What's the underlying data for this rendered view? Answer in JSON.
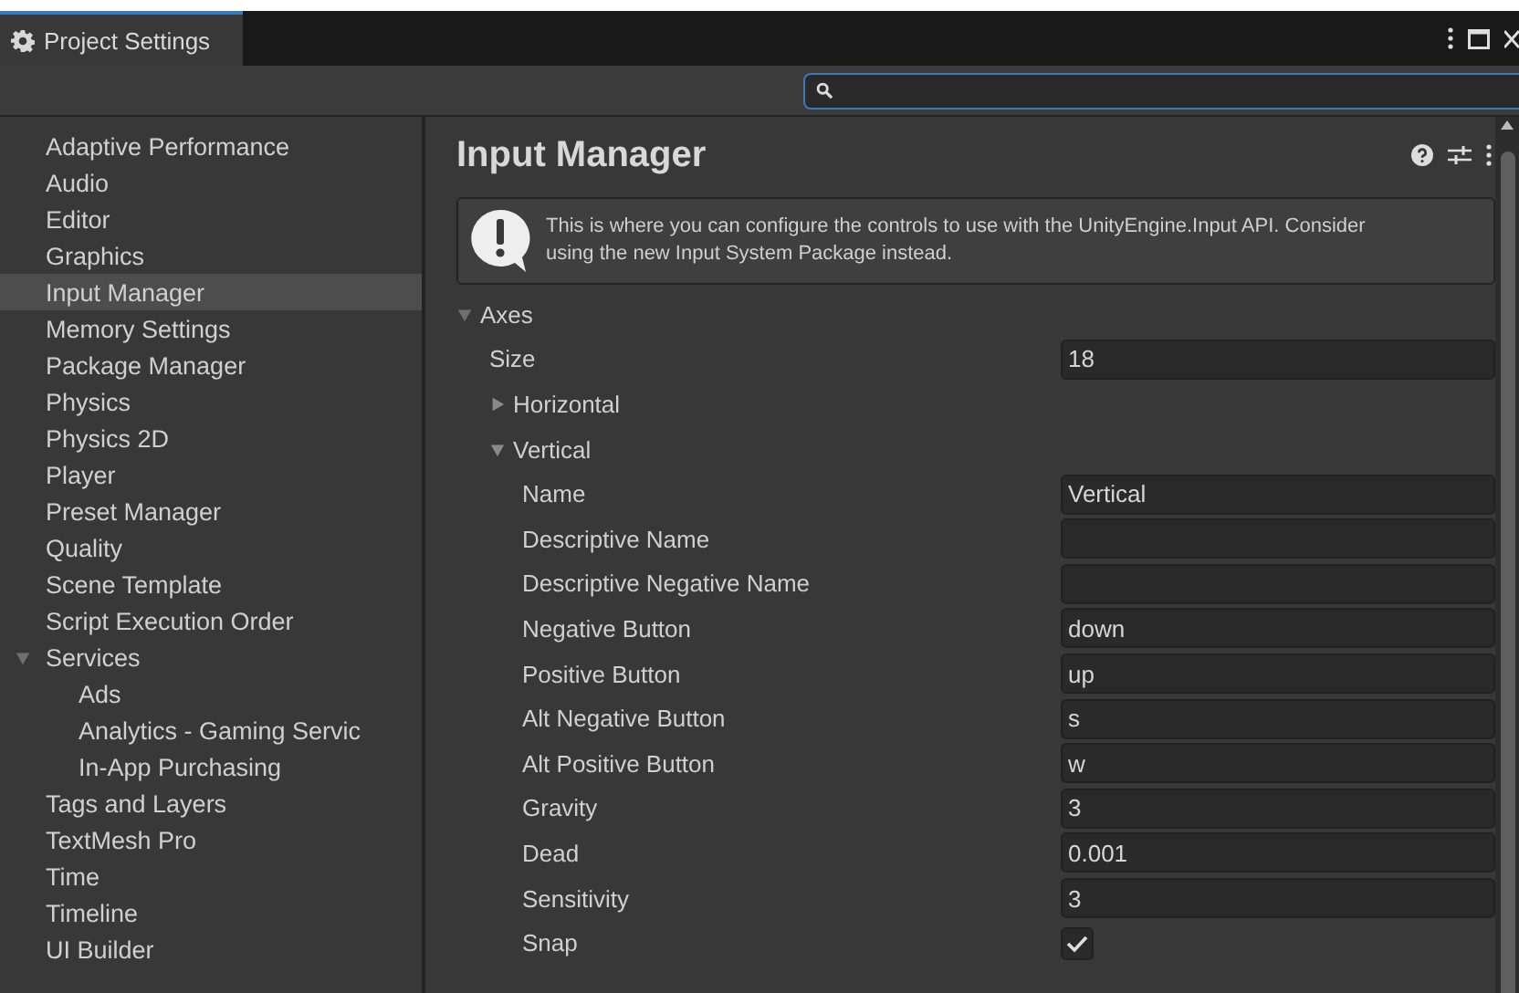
{
  "window": {
    "tab": {
      "title": "Project Settings",
      "selected": true
    }
  },
  "sidebar": {
    "items": [
      {
        "label": "Adaptive Performance",
        "selected": false
      },
      {
        "label": "Audio",
        "selected": false
      },
      {
        "label": "Editor",
        "selected": false
      },
      {
        "label": "Graphics",
        "selected": false
      },
      {
        "label": "Input Manager",
        "selected": true
      },
      {
        "label": "Memory Settings",
        "selected": false
      },
      {
        "label": "Package Manager",
        "selected": false
      },
      {
        "label": "Physics",
        "selected": false
      },
      {
        "label": "Physics 2D",
        "selected": false
      },
      {
        "label": "Player",
        "selected": false
      },
      {
        "label": "Preset Manager",
        "selected": false
      },
      {
        "label": "Quality",
        "selected": false
      },
      {
        "label": "Scene Template",
        "selected": false
      },
      {
        "label": "Script Execution Order",
        "selected": false
      },
      {
        "label": "Services",
        "selected": false,
        "expanded": true,
        "children": [
          {
            "label": "Ads",
            "selected": false
          },
          {
            "label": "Analytics - Gaming Servic",
            "selected": false
          },
          {
            "label": "In-App Purchasing",
            "selected": false
          }
        ]
      },
      {
        "label": "Tags and Layers",
        "selected": false
      },
      {
        "label": "TextMesh Pro",
        "selected": false
      },
      {
        "label": "Time",
        "selected": false
      },
      {
        "label": "Timeline",
        "selected": false
      },
      {
        "label": "UI Builder",
        "selected": false
      }
    ]
  },
  "inspector": {
    "title": "Input Manager",
    "help_box": {
      "text": "This is where you can configure the controls to use with the UnityEngine.Input API. Consider using the new Input System Package instead."
    },
    "axes": {
      "label": "Axes",
      "expanded": true,
      "size": {
        "label": "Size",
        "value": "18"
      },
      "items": [
        {
          "label": "Horizontal",
          "expanded": false
        },
        {
          "label": "Vertical",
          "expanded": true,
          "properties": [
            {
              "kind": "text",
              "label": "Name",
              "value": "Vertical"
            },
            {
              "kind": "text",
              "label": "Descriptive Name"
            },
            {
              "kind": "text",
              "label": "Descriptive Negative Name"
            },
            {
              "kind": "text",
              "label": "Negative Button",
              "value": "down"
            },
            {
              "kind": "text",
              "label": "Positive Button",
              "value": "up"
            },
            {
              "kind": "text",
              "label": "Alt Negative Button",
              "value": "s"
            },
            {
              "kind": "text",
              "label": "Alt Positive Button",
              "value": "w"
            },
            {
              "kind": "text",
              "label": "Gravity",
              "value": "3"
            },
            {
              "kind": "text",
              "label": "Dead",
              "value": "0.001"
            },
            {
              "kind": "text",
              "label": "Sensitivity",
              "value": "3"
            },
            {
              "kind": "checkbox",
              "label": "Snap",
              "checked": true
            }
          ]
        }
      ]
    }
  }
}
